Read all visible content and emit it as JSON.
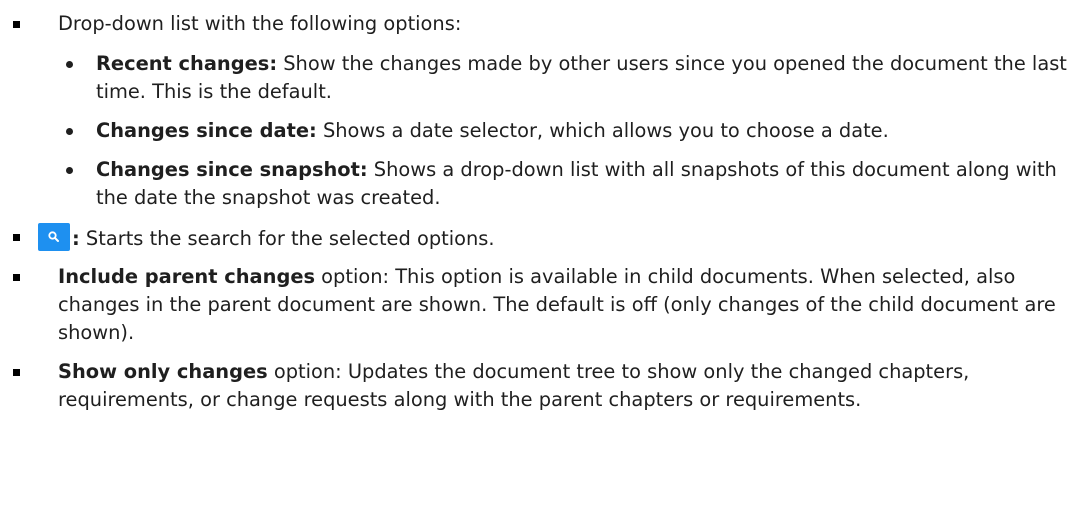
{
  "intro": {
    "text": "Drop-down list with the following options:"
  },
  "options": [
    {
      "label": "Recent changes:",
      "desc": " Show the changes made by other users since you opened the document the last time. This is the default."
    },
    {
      "label": "Changes since date:",
      "desc": " Shows a date selector, which allows you to choose a date."
    },
    {
      "label": "Changes since snapshot:",
      "desc": " Shows a drop-down list with all snapshots of this document along with the date the snapshot was created."
    }
  ],
  "search": {
    "icon": "search-icon",
    "colon": ":",
    "desc": " Starts the search for the selected options.",
    "color": "#1e90f0"
  },
  "parent_changes": {
    "label": "Include parent changes",
    "desc": " option: This option is available in child documents. When selected, also changes in the parent document are shown. The default is off (only changes of the child document are shown)."
  },
  "only_changes": {
    "label": "Show only changes",
    "desc": " option: Updates the document tree to show only the changed chapters, requirements, or change requests along with the parent chapters or requirements."
  }
}
